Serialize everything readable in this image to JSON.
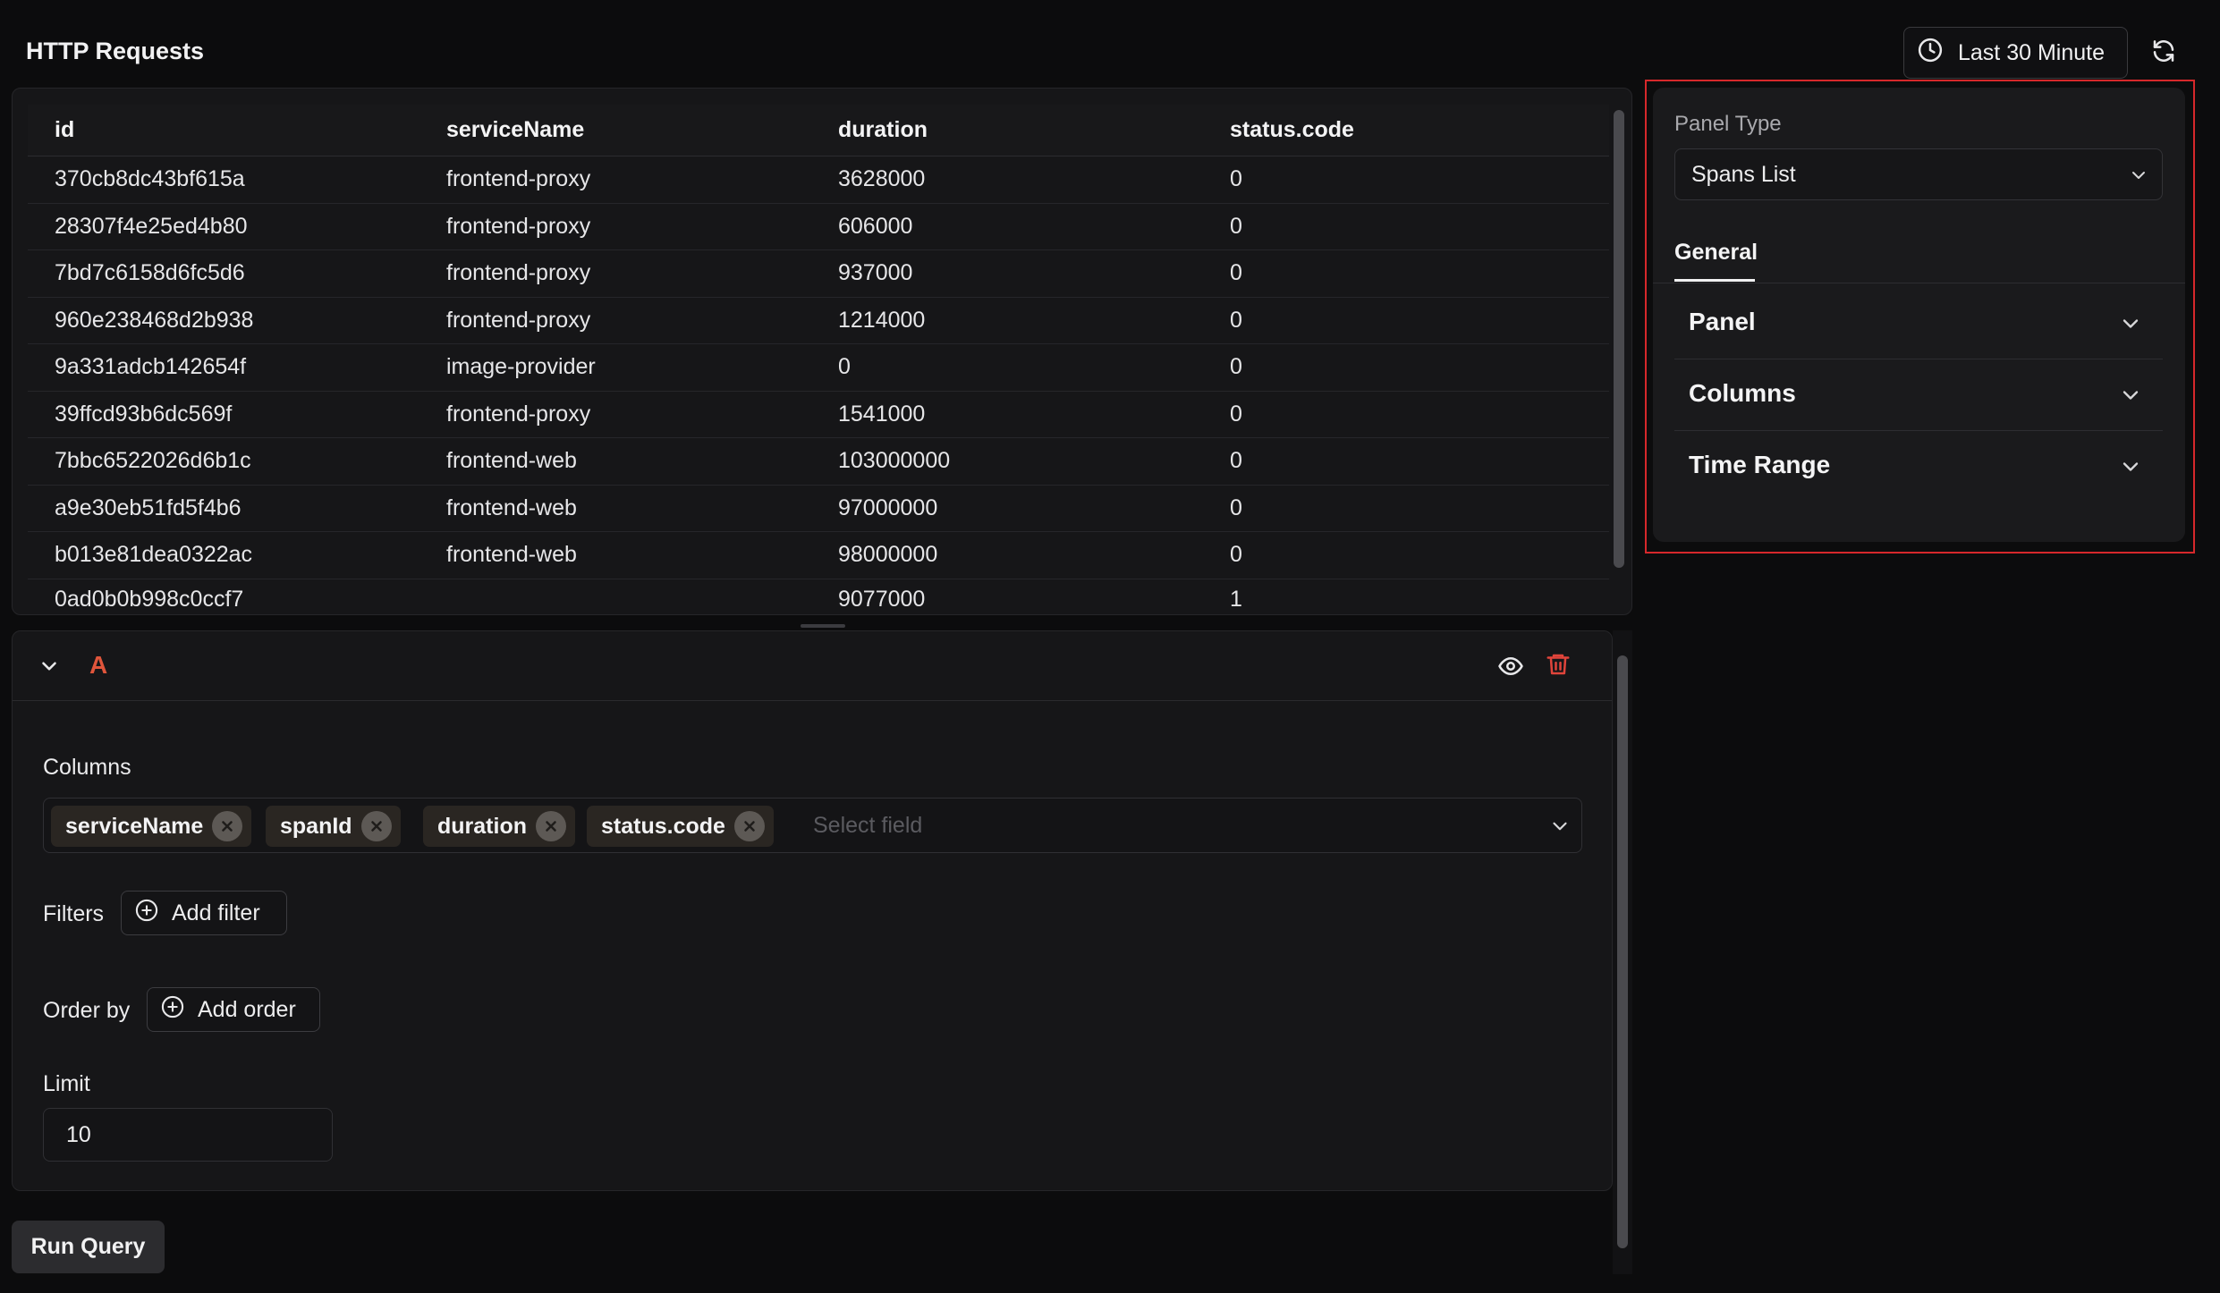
{
  "header": {
    "title": "HTTP Requests",
    "time_range_label": "Last 30 Minute",
    "icons": {
      "time": "clock-icon",
      "refresh": "refresh-icon"
    }
  },
  "results": {
    "columns": [
      "id",
      "serviceName",
      "duration",
      "status.code"
    ],
    "rows": [
      [
        "370cb8dc43bf615a",
        "frontend-proxy",
        "3628000",
        "0"
      ],
      [
        "28307f4e25ed4b80",
        "frontend-proxy",
        "606000",
        "0"
      ],
      [
        "7bd7c6158d6fc5d6",
        "frontend-proxy",
        "937000",
        "0"
      ],
      [
        "960e238468d2b938",
        "frontend-proxy",
        "1214000",
        "0"
      ],
      [
        "9a331adcb142654f",
        "image-provider",
        "0",
        "0"
      ],
      [
        "39ffcd93b6dc569f",
        "frontend-proxy",
        "1541000",
        "0"
      ],
      [
        "7bbc6522026d6b1c",
        "frontend-web",
        "103000000",
        "0"
      ],
      [
        "a9e30eb51fd5f4b6",
        "frontend-web",
        "97000000",
        "0"
      ],
      [
        "b013e81dea0322ac",
        "frontend-web",
        "98000000",
        "0"
      ]
    ],
    "partial_row": [
      "0ad0b0b998c0ccf7",
      "",
      "9077000",
      "1"
    ]
  },
  "query": {
    "letter": "A",
    "columns_label": "Columns",
    "selected_columns": [
      "serviceName",
      "spanId",
      "duration",
      "status.code"
    ],
    "select_placeholder": "Select field",
    "filters_label": "Filters",
    "add_filter_label": "Add filter",
    "order_by_label": "Order by",
    "add_order_label": "Add order",
    "limit_label": "Limit",
    "limit_value": "10",
    "icons": {
      "collapse": "chevron-down-icon",
      "visibility": "eye-icon",
      "delete": "trash-icon",
      "add": "plus-circle-icon",
      "remove": "x-circle-icon"
    },
    "colors": {
      "letter": "#e0553b",
      "delete": "#e0443b"
    }
  },
  "run_query_label": "Run Query",
  "settings": {
    "panel_type_label": "Panel Type",
    "panel_type_value": "Spans List",
    "tabs": [
      "General"
    ],
    "sections": [
      "Panel",
      "Columns",
      "Time Range"
    ],
    "highlight_color": "#d6282b"
  }
}
